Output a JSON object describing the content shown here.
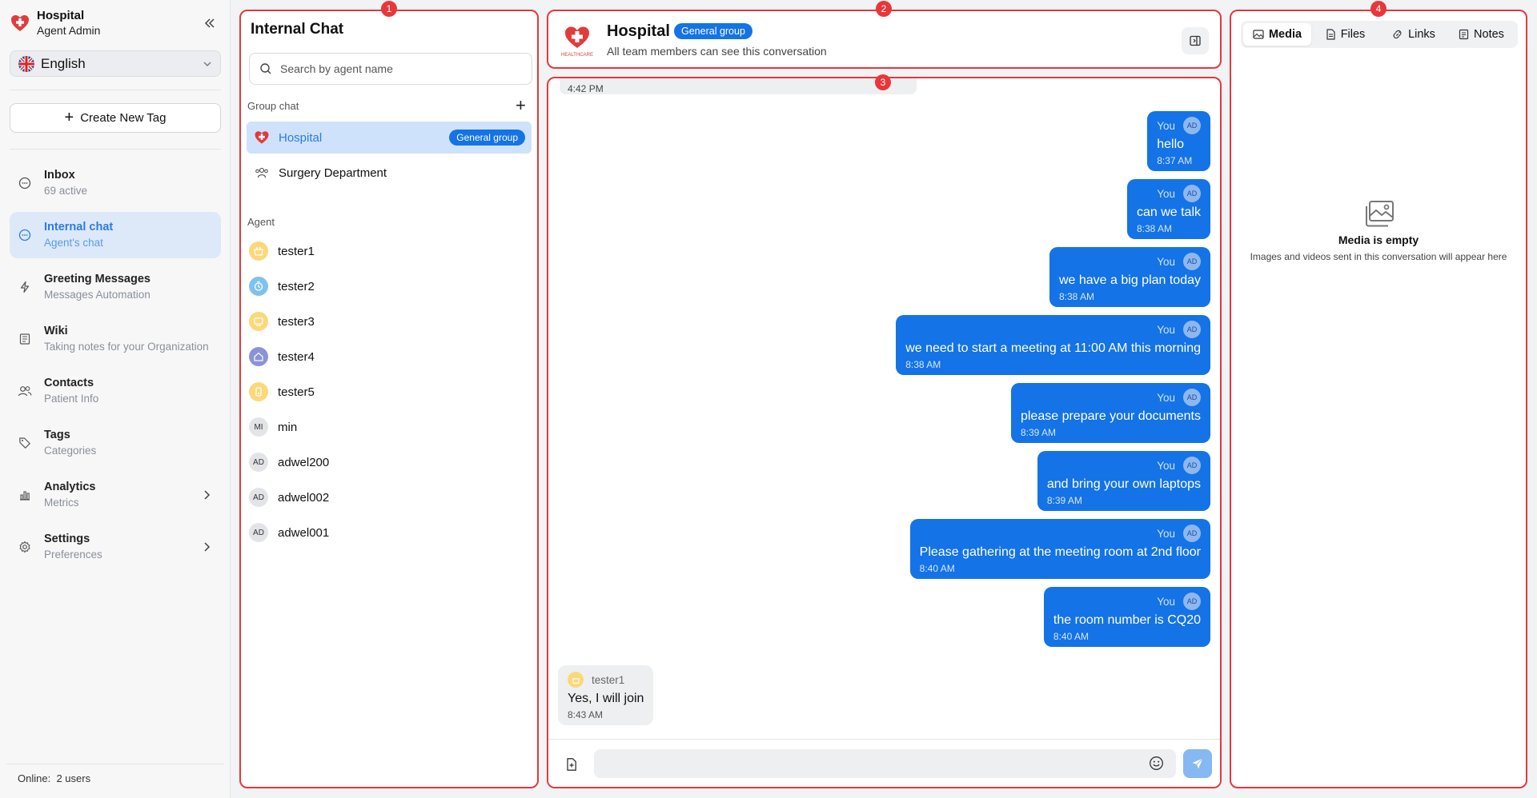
{
  "brand": {
    "name": "Hospital",
    "role": "Agent Admin",
    "logo_caption": "HEALTHCARE"
  },
  "language": {
    "selected": "English"
  },
  "create_tag_label": "Create New Tag",
  "nav": [
    {
      "title": "Inbox",
      "sub": "69 active"
    },
    {
      "title": "Internal chat",
      "sub": "Agent's chat"
    },
    {
      "title": "Greeting Messages",
      "sub": "Messages Automation"
    },
    {
      "title": "Wiki",
      "sub": "Taking notes for your Organization"
    },
    {
      "title": "Contacts",
      "sub": "Patient Info"
    },
    {
      "title": "Tags",
      "sub": "Categories"
    },
    {
      "title": "Analytics",
      "sub": "Metrics"
    },
    {
      "title": "Settings",
      "sub": "Preferences"
    }
  ],
  "online_label": "Online:",
  "online_count": "2 users",
  "panel_badges": [
    "1",
    "2",
    "3",
    "4"
  ],
  "internal_chat": {
    "title": "Internal Chat",
    "search_placeholder": "Search by agent name",
    "group_label": "Group chat",
    "groups": [
      {
        "name": "Hospital",
        "badge": "General group"
      },
      {
        "name": "Surgery Department"
      }
    ],
    "agent_label": "Agent",
    "agents": [
      {
        "name": "tester1",
        "initials": "",
        "color": "#fbd97a"
      },
      {
        "name": "tester2",
        "initials": "",
        "color": "#7ec3ef"
      },
      {
        "name": "tester3",
        "initials": "",
        "color": "#fbd97a"
      },
      {
        "name": "tester4",
        "initials": "",
        "color": "#8b93d8"
      },
      {
        "name": "tester5",
        "initials": "",
        "color": "#fbd97a"
      },
      {
        "name": "min",
        "initials": "MI",
        "color": "#e3e4e8"
      },
      {
        "name": "adwel200",
        "initials": "AD",
        "color": "#e3e4e8"
      },
      {
        "name": "adwel002",
        "initials": "AD",
        "color": "#e3e4e8"
      },
      {
        "name": "adwel001",
        "initials": "AD",
        "color": "#e3e4e8"
      }
    ]
  },
  "conversation": {
    "title": "Hospital",
    "badge": "General group",
    "subtitle": "All team members can see this conversation"
  },
  "messages": {
    "top_time": "4:42 PM",
    "outgoing": [
      {
        "sender": "You",
        "initials": "AD",
        "text": "hello",
        "time": "8:37 AM"
      },
      {
        "sender": "You",
        "initials": "AD",
        "text": "can we talk",
        "time": "8:38 AM"
      },
      {
        "sender": "You",
        "initials": "AD",
        "text": "we have a big plan today",
        "time": "8:38 AM"
      },
      {
        "sender": "You",
        "initials": "AD",
        "text": "we need to start a meeting at 11:00 AM this morning",
        "time": "8:38 AM"
      },
      {
        "sender": "You",
        "initials": "AD",
        "text": "please prepare your documents",
        "time": "8:39 AM"
      },
      {
        "sender": "You",
        "initials": "AD",
        "text": "and bring your own laptops",
        "time": "8:39 AM"
      },
      {
        "sender": "You",
        "initials": "AD",
        "text": "Please gathering at the meeting room at 2nd floor",
        "time": "8:40 AM"
      },
      {
        "sender": "You",
        "initials": "AD",
        "text": "the room number is CQ20",
        "time": "8:40 AM"
      }
    ],
    "incoming": {
      "sender": "tester1",
      "text": "Yes, I will join",
      "time": "8:43 AM"
    }
  },
  "media_panel": {
    "tabs": [
      "Media",
      "Files",
      "Links",
      "Notes"
    ],
    "empty_title": "Media is empty",
    "empty_sub": "Images and videos sent in this conversation will appear here"
  },
  "colors": {
    "accent": "#1473e6",
    "annotation": "#e8373b",
    "active_nav_bg": "#dde9f8"
  }
}
